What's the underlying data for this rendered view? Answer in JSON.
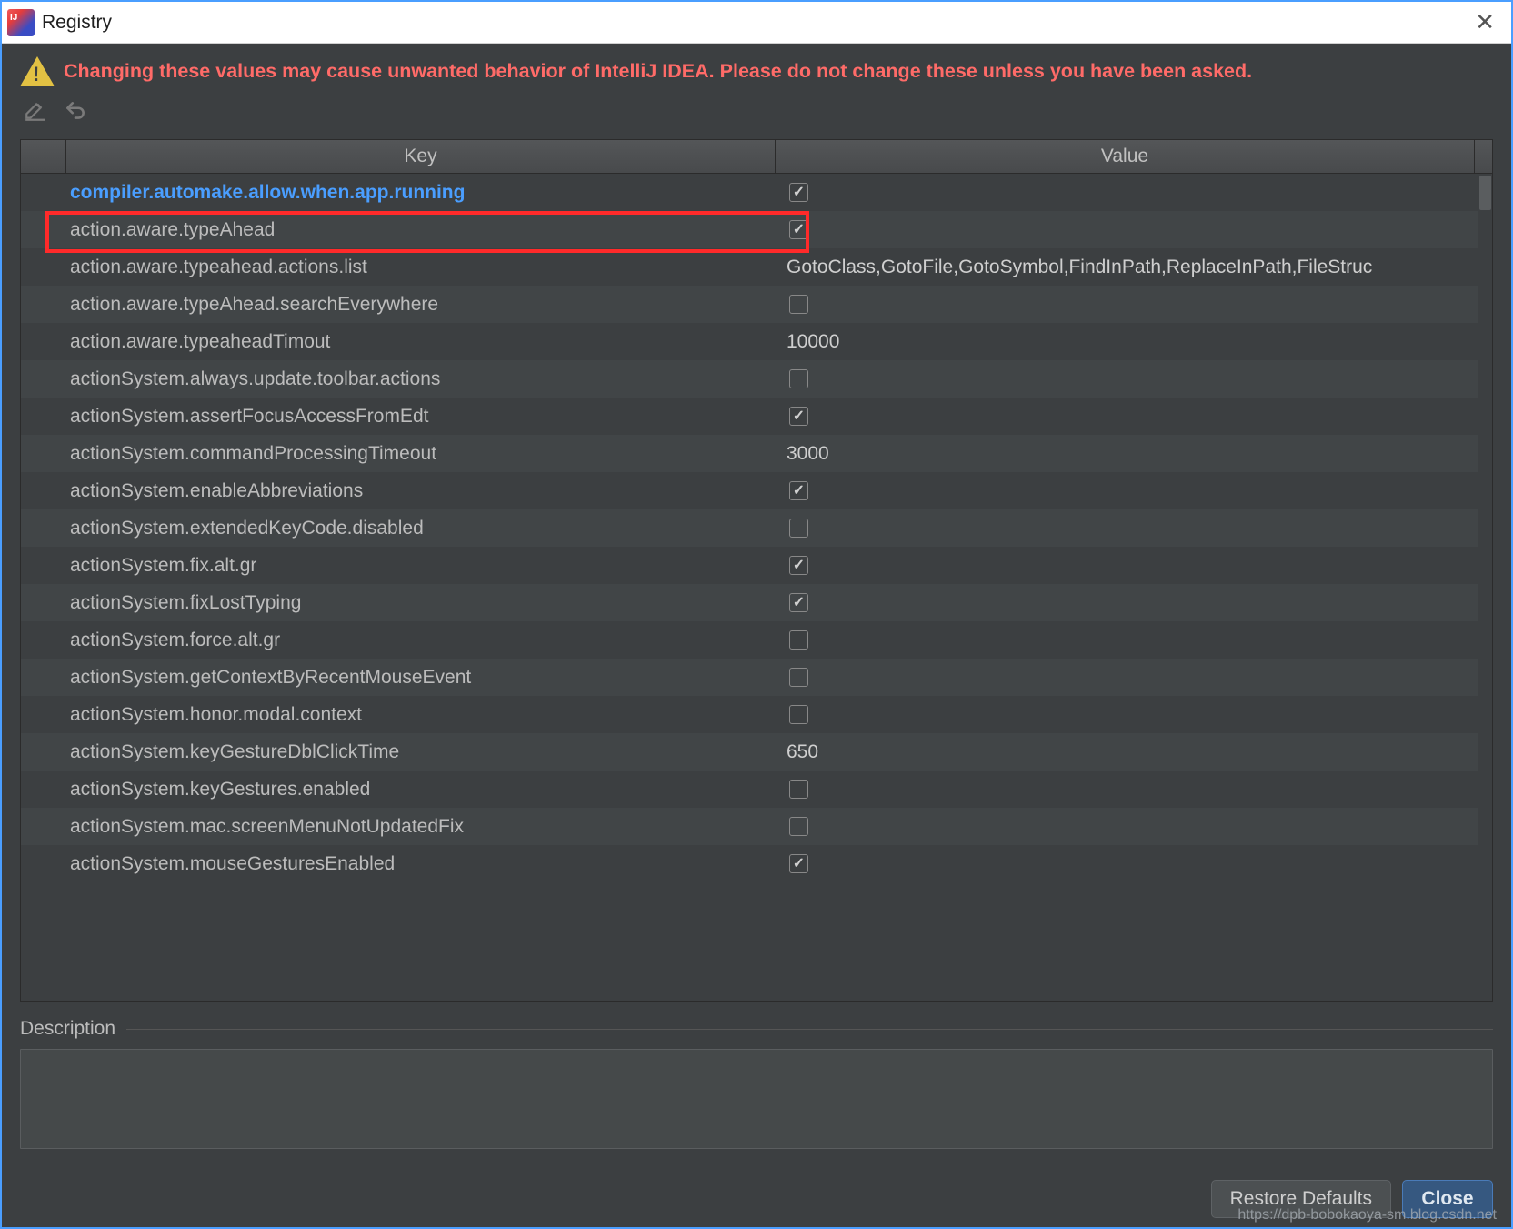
{
  "window": {
    "title": "Registry",
    "warning": "Changing these values may cause unwanted behavior of IntelliJ IDEA. Please do not change these unless you have been asked."
  },
  "headers": {
    "key": "Key",
    "value": "Value"
  },
  "rows": [
    {
      "key": "compiler.automake.allow.when.app.running",
      "type": "check",
      "checked": true,
      "highlight": true
    },
    {
      "key": "action.aware.typeAhead",
      "type": "check",
      "checked": true
    },
    {
      "key": "action.aware.typeahead.actions.list",
      "type": "text",
      "value": "GotoClass,GotoFile,GotoSymbol,FindInPath,ReplaceInPath,FileStruc"
    },
    {
      "key": "action.aware.typeAhead.searchEverywhere",
      "type": "check",
      "checked": false
    },
    {
      "key": "action.aware.typeaheadTimout",
      "type": "text",
      "value": "10000"
    },
    {
      "key": "actionSystem.always.update.toolbar.actions",
      "type": "check",
      "checked": false
    },
    {
      "key": "actionSystem.assertFocusAccessFromEdt",
      "type": "check",
      "checked": true
    },
    {
      "key": "actionSystem.commandProcessingTimeout",
      "type": "text",
      "value": "3000"
    },
    {
      "key": "actionSystem.enableAbbreviations",
      "type": "check",
      "checked": true
    },
    {
      "key": "actionSystem.extendedKeyCode.disabled",
      "type": "check",
      "checked": false
    },
    {
      "key": "actionSystem.fix.alt.gr",
      "type": "check",
      "checked": true
    },
    {
      "key": "actionSystem.fixLostTyping",
      "type": "check",
      "checked": true
    },
    {
      "key": "actionSystem.force.alt.gr",
      "type": "check",
      "checked": false
    },
    {
      "key": "actionSystem.getContextByRecentMouseEvent",
      "type": "check",
      "checked": false
    },
    {
      "key": "actionSystem.honor.modal.context",
      "type": "check",
      "checked": false
    },
    {
      "key": "actionSystem.keyGestureDblClickTime",
      "type": "text",
      "value": "650"
    },
    {
      "key": "actionSystem.keyGestures.enabled",
      "type": "check",
      "checked": false
    },
    {
      "key": "actionSystem.mac.screenMenuNotUpdatedFix",
      "type": "check",
      "checked": false
    },
    {
      "key": "actionSystem.mouseGesturesEnabled",
      "type": "check",
      "checked": true
    }
  ],
  "description": {
    "label": "Description"
  },
  "buttons": {
    "restore": "Restore Defaults",
    "close": "Close"
  },
  "watermark": "https://dpb-bobokaoya-sm.blog.csdn.net"
}
